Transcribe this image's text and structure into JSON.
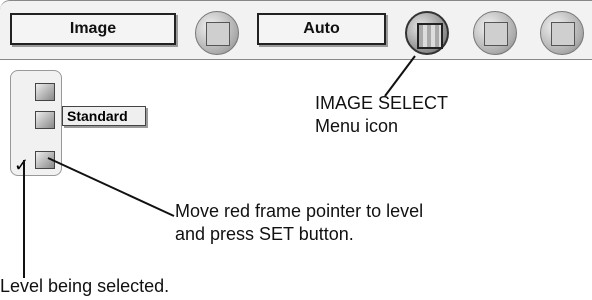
{
  "menubar": {
    "image_button": "Image",
    "auto_button": "Auto"
  },
  "panel": {
    "selected_label": "Standard"
  },
  "captions": {
    "menu_icon_line1": "IMAGE SELECT",
    "menu_icon_line2": "Menu icon",
    "move_line1": "Move red frame pointer to level",
    "move_line2": "and press SET button.",
    "level": "Level being selected."
  },
  "icons": {
    "check": "✓"
  }
}
